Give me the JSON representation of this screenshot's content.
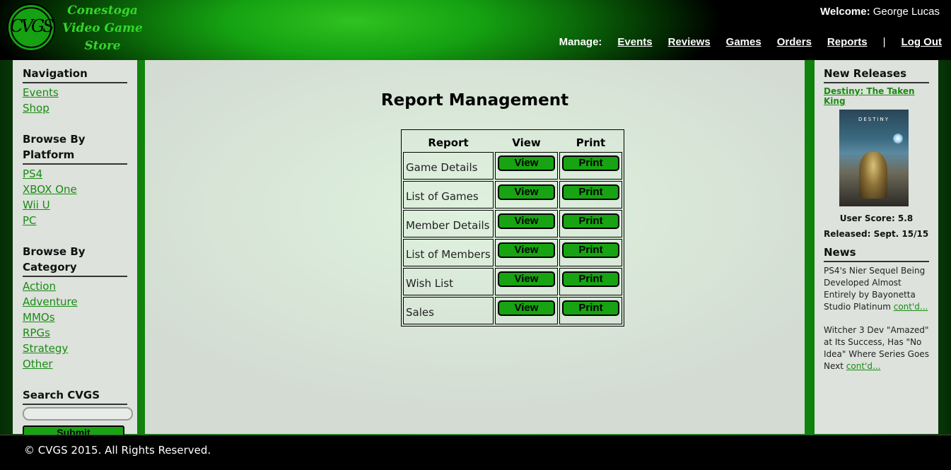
{
  "header": {
    "logo_letters": "CVGS",
    "store_name_lines": [
      "Conestoga",
      "Video  Game",
      "Store"
    ],
    "welcome_label": "Welcome:",
    "welcome_user": "George Lucas",
    "manage_label": "Manage:",
    "nav": [
      "Events",
      "Reviews",
      "Games",
      "Orders",
      "Reports"
    ],
    "separator": "|",
    "logout": "Log Out"
  },
  "sidebar": {
    "navigation_heading": "Navigation",
    "navigation_links": [
      "Events",
      "Shop"
    ],
    "platform_heading": "Browse By Platform",
    "platform_links": [
      "PS4",
      "XBOX One",
      "Wii U",
      "PC"
    ],
    "category_heading": "Browse By Category",
    "category_links": [
      "Action",
      "Adventure",
      "MMOs",
      "RPGs",
      "Strategy",
      "Other"
    ],
    "search_heading": "Search CVGS",
    "search_value": "",
    "submit_label": "Submit"
  },
  "main": {
    "title": "Report Management",
    "columns": [
      "Report",
      "View",
      "Print"
    ],
    "rows": [
      {
        "name": "Game Details",
        "view": "View",
        "print": "Print"
      },
      {
        "name": "List of Games",
        "view": "View",
        "print": "Print"
      },
      {
        "name": "Member Details",
        "view": "View",
        "print": "Print"
      },
      {
        "name": "List of Members",
        "view": "View",
        "print": "Print"
      },
      {
        "name": "Wish List",
        "view": "View",
        "print": "Print"
      },
      {
        "name": "Sales",
        "view": "View",
        "print": "Print"
      }
    ]
  },
  "right": {
    "releases_heading": "New Releases",
    "release_title": "Destiny: The Taken King",
    "cover_text": "DESTINY",
    "user_score": "User Score: 5.8",
    "released": "Released: Sept. 15/15",
    "news_heading": "News",
    "news": [
      {
        "text": "PS4's Nier Sequel Being Developed Almost Entirely by Bayonetta Studio Platinum ",
        "link": "cont'd..."
      },
      {
        "text": "Witcher 3 Dev \"Amazed\" at Its Success, Has \"No Idea\" Where Series Goes Next ",
        "link": "cont'd..."
      }
    ]
  },
  "footer": {
    "text": "© CVGS 2015. All Rights Reserved."
  }
}
